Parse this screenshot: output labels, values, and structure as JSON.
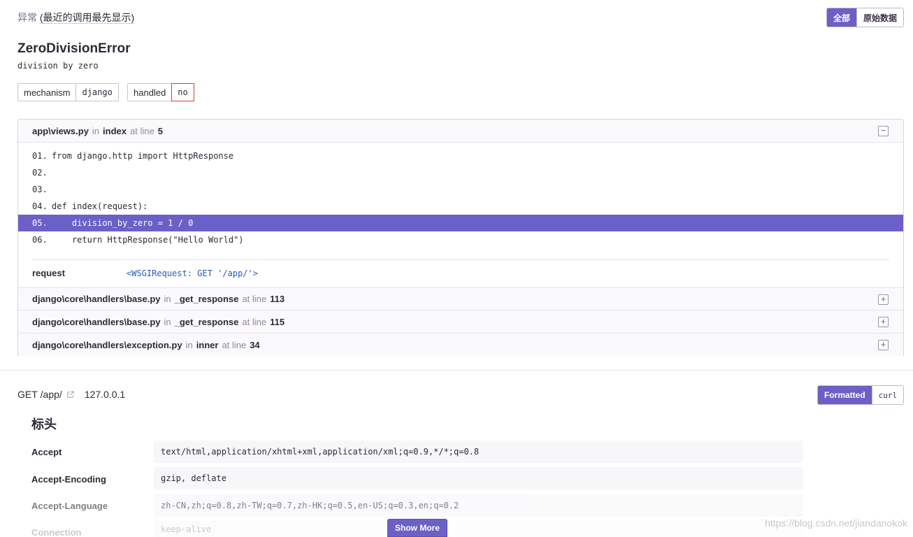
{
  "exception": {
    "label": "异常",
    "subtitle": "(最近的调用最先显示)",
    "toggle_all": "全部",
    "toggle_raw": "原始数据",
    "type": "ZeroDivisionError",
    "message": "division by zero",
    "tags": [
      {
        "key": "mechanism",
        "value": "django"
      },
      {
        "key": "handled",
        "value": "no"
      }
    ]
  },
  "frames": [
    {
      "file": "app\\views.py",
      "in": "in",
      "function": "index",
      "at": "at line",
      "line": "5",
      "toggle": "−",
      "code": [
        {
          "num": "01.",
          "text": "from django.http import HttpResponse"
        },
        {
          "num": "02.",
          "text": ""
        },
        {
          "num": "03.",
          "text": ""
        },
        {
          "num": "04.",
          "text": "def index(request):"
        },
        {
          "num": "05.",
          "text": "    division_by_zero = 1 / 0"
        },
        {
          "num": "06.",
          "text": "    return HttpResponse(\"Hello World\")"
        }
      ],
      "vars": [
        {
          "key": "request",
          "value": "<WSGIRequest: GET '/app/'>"
        }
      ]
    },
    {
      "file": "django\\core\\handlers\\base.py",
      "in": "in",
      "function": "_get_response",
      "at": "at line",
      "line": "113",
      "toggle": "+"
    },
    {
      "file": "django\\core\\handlers\\base.py",
      "in": "in",
      "function": "_get_response",
      "at": "at line",
      "line": "115",
      "toggle": "+"
    },
    {
      "file": "django\\core\\handlers\\exception.py",
      "in": "in",
      "function": "inner",
      "at": "at line",
      "line": "34",
      "toggle": "+"
    }
  ],
  "request": {
    "method": "GET",
    "path": "/app/",
    "ip": "127.0.0.1",
    "toggle_formatted": "Formatted",
    "toggle_curl": "curl",
    "section_title": "标头",
    "headers": [
      {
        "key": "Accept",
        "value": "text/html,application/xhtml+xml,application/xml;q=0.9,*/*;q=0.8"
      },
      {
        "key": "Accept-Encoding",
        "value": "gzip, deflate"
      },
      {
        "key": "Accept-Language",
        "value": "zh-CN,zh;q=0.8,zh-TW;q=0.7,zh-HK;q=0.5,en-US;q=0.3,en;q=0.2"
      },
      {
        "key": "Connection",
        "value": "keep-alive"
      }
    ],
    "show_more": "Show More"
  },
  "watermark": "https://blog.csdn.net/jiandanokok",
  "colors": {
    "accent": "#6c5fc7",
    "link": "#2a5db0",
    "danger": "#e03e2f"
  }
}
